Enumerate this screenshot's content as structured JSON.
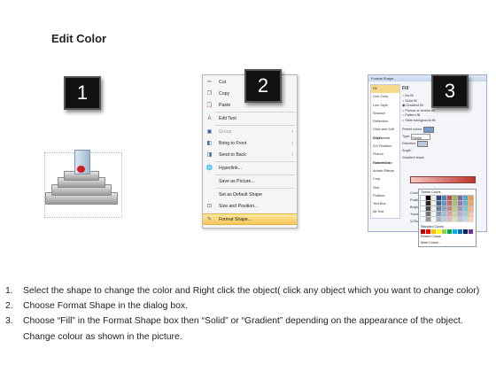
{
  "title": "Edit Color",
  "badges": [
    "1",
    "2",
    "3"
  ],
  "context_menu": {
    "items": [
      {
        "label": "Cut",
        "icon": "scissors-icon",
        "glyph": "✂"
      },
      {
        "label": "Copy",
        "icon": "copy-icon",
        "glyph": "❐"
      },
      {
        "label": "Paste",
        "icon": "paste-icon",
        "glyph": "📋"
      },
      {
        "label": "Edit Text",
        "icon": "edit-text-icon",
        "glyph": "A"
      },
      {
        "label": "Group",
        "icon": "group-icon",
        "glyph": "▣"
      },
      {
        "label": "Bring to Front",
        "icon": "bring-front-icon",
        "glyph": "◧"
      },
      {
        "label": "Send to Back",
        "icon": "send-back-icon",
        "glyph": "◨"
      },
      {
        "label": "Hyperlink...",
        "icon": "hyperlink-icon",
        "glyph": "🌐"
      },
      {
        "label": "Save as Picture...",
        "icon": "",
        "glyph": ""
      },
      {
        "label": "Set as Default Shape",
        "icon": "",
        "glyph": ""
      },
      {
        "label": "Size and Position...",
        "icon": "size-icon",
        "glyph": "⊡"
      },
      {
        "label": "Format Shape...",
        "icon": "format-shape-icon",
        "glyph": "✎"
      }
    ]
  },
  "format_dialog": {
    "title": "Format Shape",
    "sections": [
      "Fill",
      "Line Color",
      "Line Style",
      "Shadow",
      "Reflection",
      "Glow and Soft Edges",
      "3-D Format",
      "3-D Rotation",
      "Picture Corrections",
      "Picture Color",
      "Artistic Effects",
      "Crop",
      "Size",
      "Position",
      "Text Box",
      "Alt Text"
    ],
    "fill_heading": "Fill",
    "fill_options": [
      "No fill",
      "Solid fill",
      "Gradient fill",
      "Picture or texture fill",
      "Pattern fill",
      "Slide background fill"
    ],
    "fields": [
      "Preset colors:",
      "Type:",
      "Direction:",
      "Angle:",
      "Gradient stops",
      "Color",
      "Position:",
      "Brightness:",
      "Transparency:",
      "Rotate with shape"
    ],
    "type_value": "Radial",
    "palette_theme_label": "Theme Colors",
    "palette_standard_label": "Standard Colors",
    "palette_recent_label": "Recent Colors",
    "palette_more_label": "More Colors...",
    "colors": {
      "theme": [
        "#ffffff",
        "#000000",
        "#eeece1",
        "#1f497d",
        "#4f81bd",
        "#c0504d",
        "#9bbb59",
        "#8064a2",
        "#4bacc6",
        "#f79646"
      ],
      "standard": [
        "#c00000",
        "#ff0000",
        "#ffc000",
        "#ffff00",
        "#92d050",
        "#00b050",
        "#00b0f0",
        "#0070c0",
        "#002060",
        "#7030a0"
      ],
      "gradient_bar": [
        "#f4c9c4",
        "#c0342b"
      ]
    }
  },
  "steps": [
    {
      "num": "1.",
      "text": "Select the shape to change the color and Right click the object( click any object which you want to change color)"
    },
    {
      "num": "2.",
      "text": "Choose Format Shape in the dialog box."
    },
    {
      "num": "3.",
      "text": "Choose “Fill” in the Format Shape box then “Solid” or “Gradient” depending on the appearance of the object. Change colour as shown in the picture."
    }
  ]
}
